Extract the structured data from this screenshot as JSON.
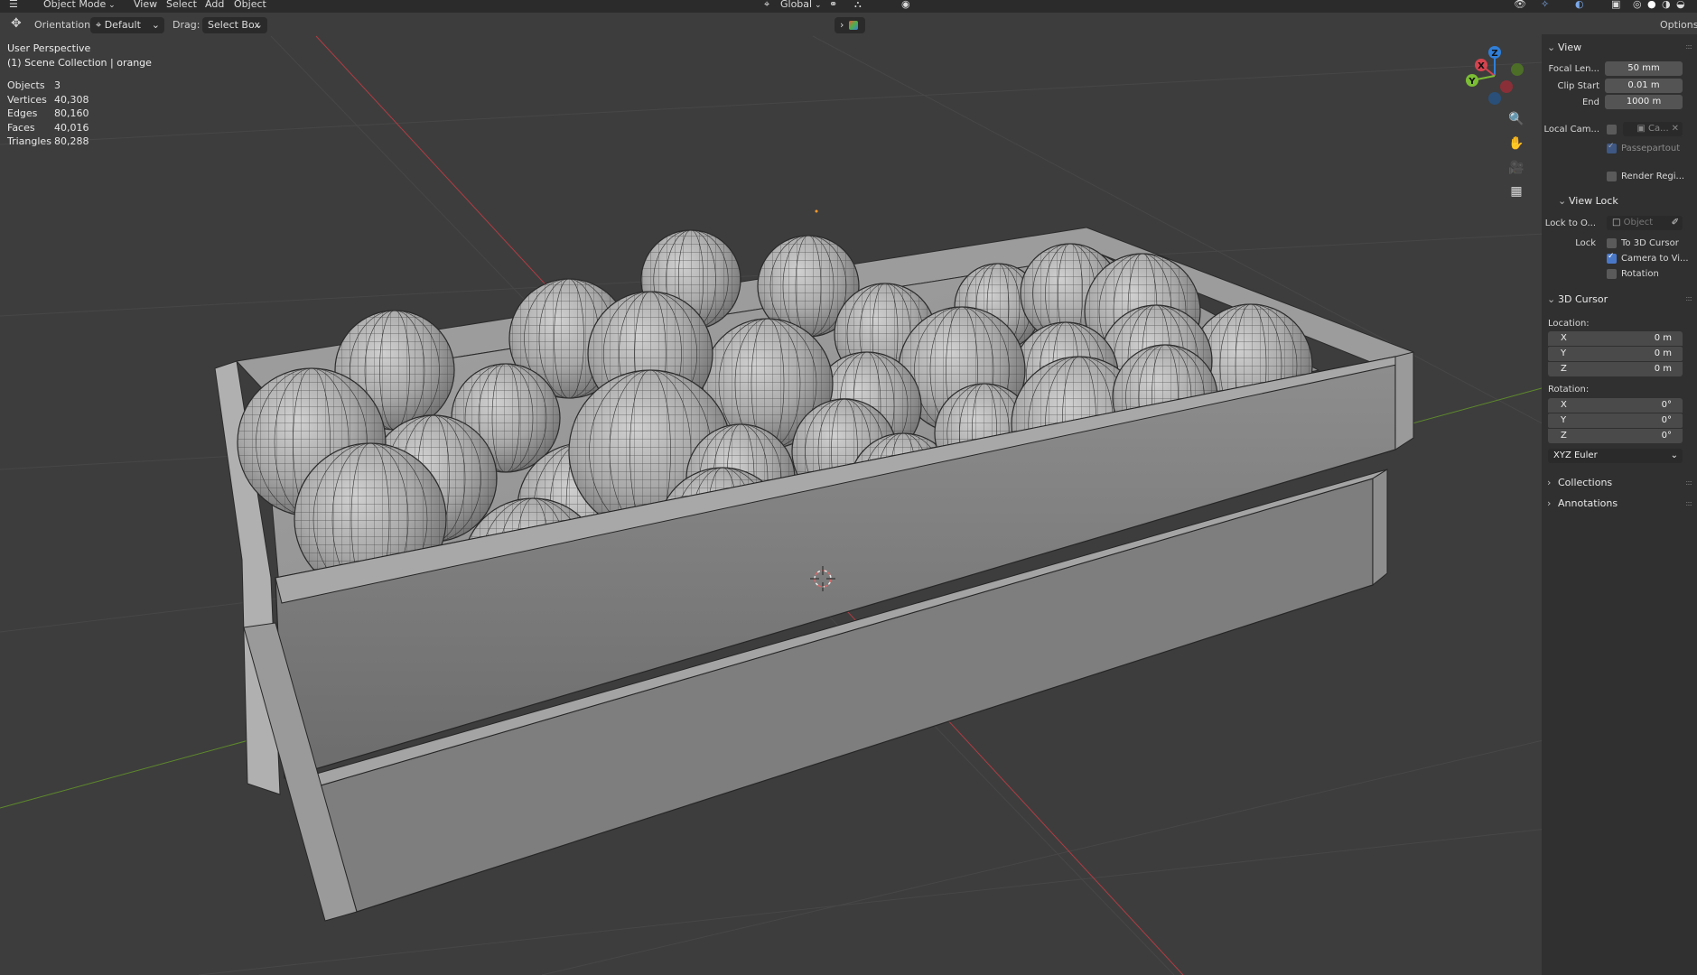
{
  "header": {
    "mode": "Object Mode",
    "menus": [
      "View",
      "Select",
      "Add",
      "Object"
    ],
    "transform_orientation": "Global"
  },
  "toolbar": {
    "orientation_label": "Orientation:",
    "orientation_value": "Default",
    "drag_label": "Drag:",
    "drag_value": "Select Box",
    "options_label": "Options"
  },
  "viewport": {
    "perspective": "User Perspective",
    "collection": "(1) Scene Collection | orange",
    "stats": [
      {
        "key": "Objects",
        "value": "3"
      },
      {
        "key": "Vertices",
        "value": "40,308"
      },
      {
        "key": "Edges",
        "value": "80,160"
      },
      {
        "key": "Faces",
        "value": "40,016"
      },
      {
        "key": "Triangles",
        "value": "80,288"
      }
    ],
    "gizmo_axes": [
      "Z",
      "X",
      "Y"
    ],
    "axis_colors": {
      "x": "#d4434f",
      "y": "#7bbd34",
      "z": "#2f7fd9"
    }
  },
  "npanel": {
    "view_section": "View",
    "focal_length_label": "Focal Len...",
    "focal_length_value": "50 mm",
    "clip_start_label": "Clip Start",
    "clip_start_value": "0.01 m",
    "clip_end_label": "End",
    "clip_end_value": "1000 m",
    "local_camera_label": "Local Cam...",
    "local_camera_value": "Ca...",
    "passepartout_label": "Passepartout",
    "render_region_label": "Render Regi...",
    "view_lock_section": "View Lock",
    "lock_to_object_label": "Lock to O...",
    "lock_to_object_placeholder": "Object",
    "lock_label": "Lock",
    "to_3d_cursor_label": "To 3D Cursor",
    "camera_to_view_label": "Camera to Vi...",
    "rotation_lock_label": "Rotation",
    "cursor_section": "3D Cursor",
    "location_label": "Location:",
    "location": [
      {
        "axis": "X",
        "value": "0 m"
      },
      {
        "axis": "Y",
        "value": "0 m"
      },
      {
        "axis": "Z",
        "value": "0 m"
      }
    ],
    "rotation_label": "Rotation:",
    "rotation": [
      {
        "axis": "X",
        "value": "0°"
      },
      {
        "axis": "Y",
        "value": "0°"
      },
      {
        "axis": "Z",
        "value": "0°"
      }
    ],
    "rotation_mode": "XYZ Euler",
    "collections_section": "Collections",
    "annotations_section": "Annotations",
    "camera_to_view_checked": true,
    "passepartout_checked": true
  }
}
